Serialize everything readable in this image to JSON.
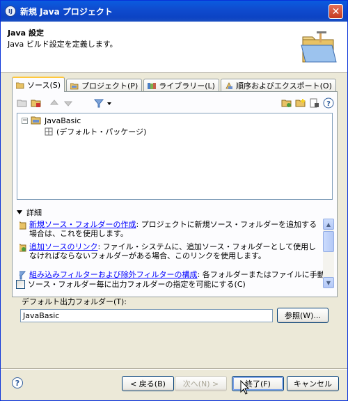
{
  "window": {
    "title": "新規 Java プロジェクト",
    "close_label": "✕"
  },
  "header": {
    "title": "Java 設定",
    "description": "Java ビルド設定を定義します。"
  },
  "tabs": [
    {
      "label": "ソース(S)",
      "icon": "source-folder-icon",
      "active": true
    },
    {
      "label": "プロジェクト(P)",
      "icon": "project-folder-icon",
      "active": false
    },
    {
      "label": "ライブラリー(L)",
      "icon": "library-icon",
      "active": false
    },
    {
      "label": "順序およびエクスポート(O)",
      "icon": "order-export-icon",
      "active": false
    }
  ],
  "tree": {
    "root": {
      "label": "JavaBasic",
      "expander": "−"
    },
    "child": {
      "label": "(デフォルト・パッケージ)"
    }
  },
  "details": {
    "heading": "詳細",
    "items": [
      {
        "link": "新規ソース・フォルダーの作成",
        "text": ": プロジェクトに新規ソース・フォルダーを追加する場合は、これを使用します。"
      },
      {
        "link": "追加ソースのリンク",
        "text": ": ファイル・システムに、追加ソース・フォルダーとして使用しなければならないフォルダーがある場合、このリンクを使用します。"
      },
      {
        "link": "組み込みフィルターおよび除外フィルターの構成",
        "text": ": 各フォルダーまたはファイルに手動での"
      }
    ]
  },
  "options": {
    "per_folder_output_label": "ソース・フォルダー毎に出力フォルダーの指定を可能にする(C)",
    "per_folder_output_checked": false,
    "default_output_label": "デフォルト出力フォルダー(T):",
    "default_output_value": "JavaBasic",
    "browse_label": "参照(W)..."
  },
  "buttons": {
    "help": "?",
    "back": "< 戻る(B)",
    "next": "次へ(N) >",
    "finish": "終了(F)",
    "cancel": "キャンセル"
  },
  "colors": {
    "title_bar": "#0c43c4",
    "link": "#0000ff",
    "tab_highlight": "#ffc83c"
  }
}
